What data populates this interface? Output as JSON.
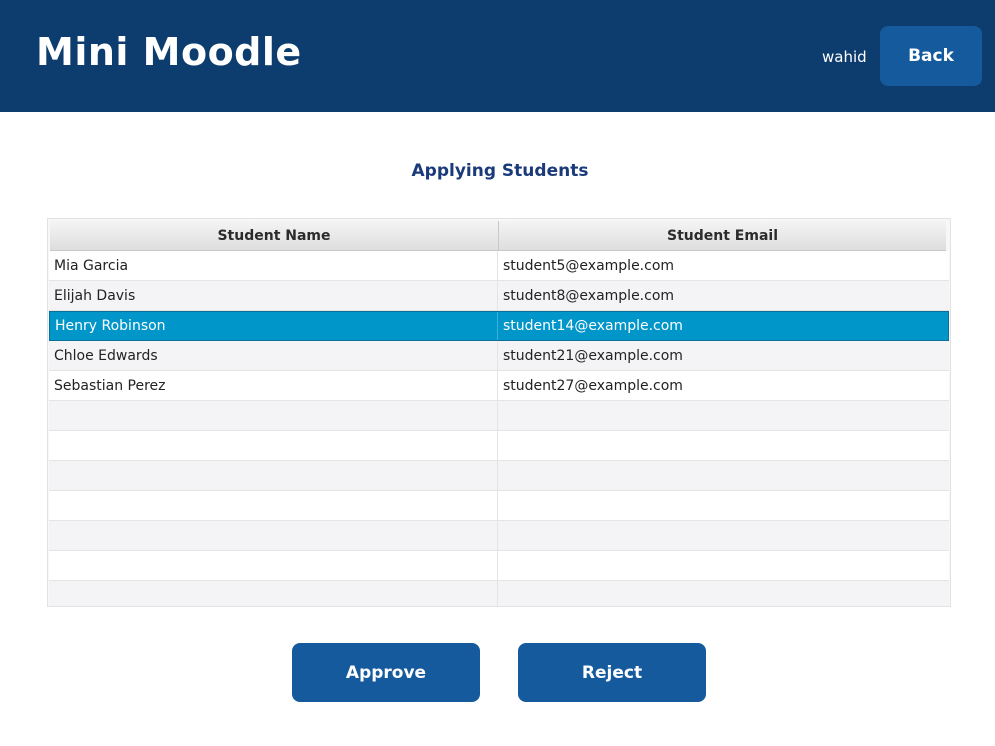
{
  "header": {
    "title": "Mini Moodle",
    "username": "wahid",
    "back_label": "Back"
  },
  "main": {
    "section_title": "Applying Students",
    "columns": [
      "Student Name",
      "Student Email"
    ],
    "rows": [
      {
        "name": "Mia Garcia",
        "email": "student5@example.com"
      },
      {
        "name": "Elijah Davis",
        "email": "student8@example.com"
      },
      {
        "name": "Henry Robinson",
        "email": "student14@example.com"
      },
      {
        "name": "Chloe Edwards",
        "email": "student21@example.com"
      },
      {
        "name": "Sebastian Perez",
        "email": "student27@example.com"
      }
    ],
    "selected_row_index": 2
  },
  "actions": {
    "approve_label": "Approve",
    "reject_label": "Reject"
  },
  "colors": {
    "header_bg": "#0d3d6e",
    "button_bg": "#155a9c",
    "selection": "#0096c9",
    "section_title": "#1a3a7a"
  }
}
